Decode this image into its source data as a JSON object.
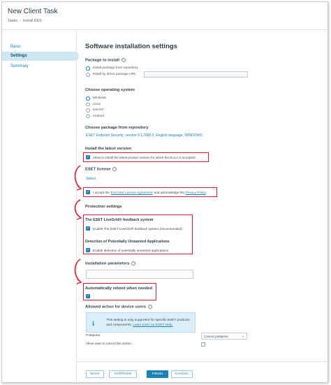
{
  "window": {
    "title": "New Client Task"
  },
  "breadcrumb": {
    "root": "Tasks",
    "current": "Install EES"
  },
  "sidebar": {
    "items": [
      {
        "label": "Basic"
      },
      {
        "label": "Settings"
      },
      {
        "label": "Summary"
      }
    ]
  },
  "main": {
    "title": "Software installation settings",
    "package_to_install": {
      "label": "Package to install",
      "options": [
        "Install package from repository",
        "Install by direct package URL"
      ]
    },
    "os": {
      "label": "Choose operating system",
      "options": [
        "Windows",
        "Linux",
        "macOS",
        "Android"
      ]
    },
    "repo_package": {
      "label": "Choose package from repository",
      "value": "ESET Endpoint Security; version 9.1.2060.0, English language, WINDOWS"
    },
    "latest": {
      "label": "Install the latest version",
      "checkbox": "Allow to install the latest product version for which the EULA is accepted"
    },
    "license": {
      "label": "ESET license",
      "select_link": "Select",
      "accept_prefix": "I accept the",
      "eula_link": "End User License Agreement",
      "accept_middle": "and acknowledge the",
      "privacy_link": "Privacy Policy",
      "accept_suffix": "."
    },
    "protection": {
      "label": "Protection settings",
      "livegrid_title": "The ESET LiveGrid® feedback system",
      "livegrid_checkbox": "Enable The ESET LiveGrid® feedback system (recommended)",
      "pua_title": "Detection of Potentially Unwanted Applications",
      "pua_checkbox": "Enable detection of potentially unwanted applications"
    },
    "params": {
      "label": "Installation parameters"
    },
    "reboot": {
      "label": "Automatically reboot when needed"
    },
    "allowed": {
      "label": "Allowed action for device users",
      "info_line1": "This setting is only supported for specific ESET products",
      "info_line2_prefix": "and components.",
      "info_link": "Learn more on ESET Help.",
      "postpone_label": "Postpone",
      "postpone_value": "Cannot postpone",
      "cancel_label": "Allow user to cancel the action"
    }
  },
  "footer": {
    "back": "BACK",
    "continue": "CONTINUE",
    "finish": "FINISH",
    "cancel": "CANCEL"
  },
  "colors": {
    "accent": "#1a82b5",
    "highlight": "#d0202a",
    "active_nav": "#cfe6f3"
  }
}
